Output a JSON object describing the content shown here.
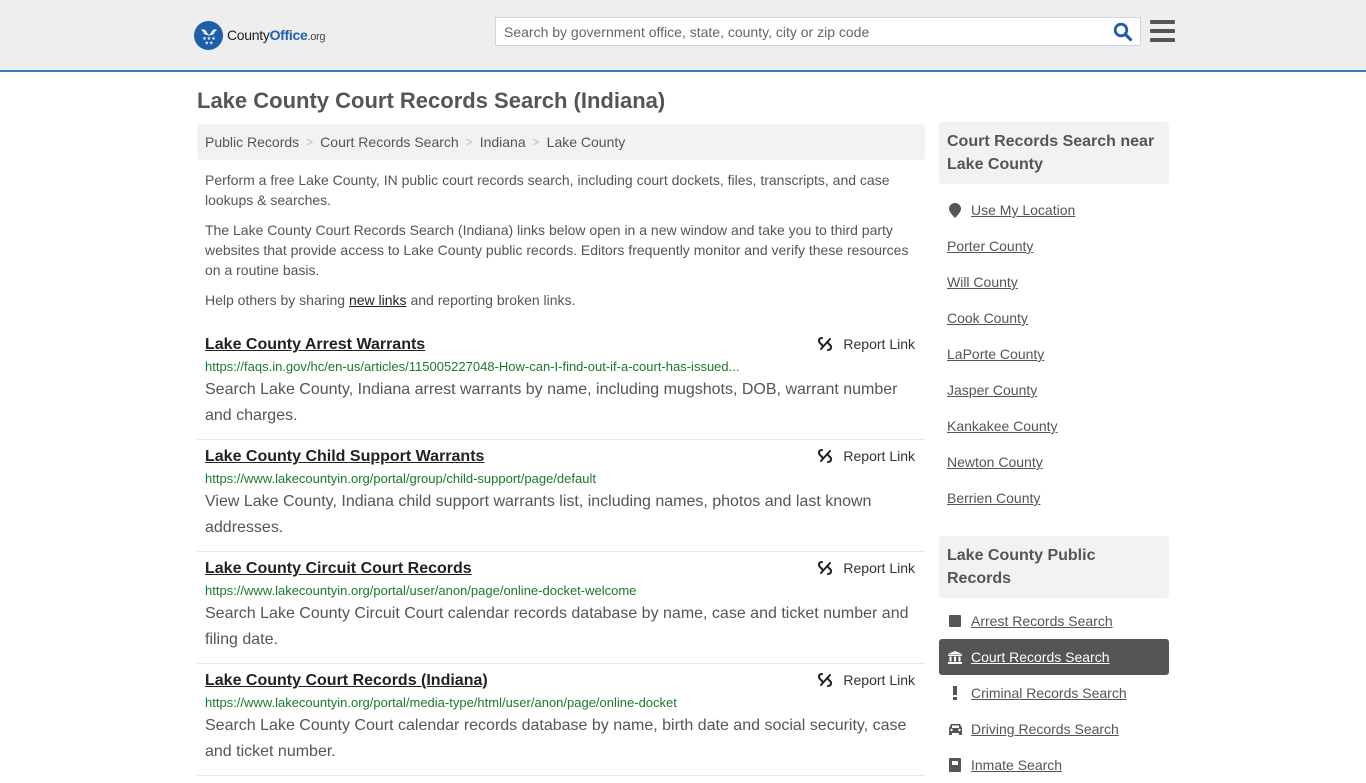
{
  "header": {
    "logo": {
      "county": "County",
      "office": "Office",
      "org": ".org"
    },
    "search": {
      "placeholder": "Search by government office, state, county, city or zip code",
      "value": ""
    },
    "colors": {
      "brand": "#1d5fa8",
      "accent_border": "#3a7ab8",
      "url_green": "#1a7a2b"
    }
  },
  "page": {
    "title": "Lake County Court Records Search (Indiana)",
    "breadcrumb": [
      "Public Records",
      "Court Records Search",
      "Indiana",
      "Lake County"
    ],
    "intro": {
      "p1": "Perform a free Lake County, IN public court records search, including court dockets, files, transcripts, and case lookups & searches.",
      "p2": "The Lake County Court Records Search (Indiana) links below open in a new window and take you to third party websites that provide access to Lake County public records. Editors frequently monitor and verify these resources on a routine basis.",
      "p3_before": "Help others by sharing ",
      "p3_link": "new links",
      "p3_after": " and reporting broken links."
    },
    "report_label": "Report Link",
    "results": [
      {
        "title": "Lake County Arrest Warrants",
        "url": "https://faqs.in.gov/hc/en-us/articles/115005227048-How-can-I-find-out-if-a-court-has-issued...",
        "desc": "Search Lake County, Indiana arrest warrants by name, including mugshots, DOB, warrant number and charges."
      },
      {
        "title": "Lake County Child Support Warrants",
        "url": "https://www.lakecountyin.org/portal/group/child-support/page/default",
        "desc": "View Lake County, Indiana child support warrants list, including names, photos and last known addresses."
      },
      {
        "title": "Lake County Circuit Court Records",
        "url": "https://www.lakecountyin.org/portal/user/anon/page/online-docket-welcome",
        "desc": "Search Lake County Circuit Court calendar records database by name, case and ticket number and filing date."
      },
      {
        "title": "Lake County Court Records (Indiana)",
        "url": "https://www.lakecountyin.org/portal/media-type/html/user/anon/page/online-docket",
        "desc": "Search Lake County Court calendar records database by name, birth date and social security, case and ticket number."
      }
    ]
  },
  "sidebar": {
    "nearby": {
      "heading": "Court Records Search near Lake County",
      "use_location": "Use My Location",
      "counties": [
        "Porter County",
        "Will County",
        "Cook County",
        "LaPorte County",
        "Jasper County",
        "Kankakee County",
        "Newton County",
        "Berrien County"
      ]
    },
    "public_records": {
      "heading": "Lake County Public Records",
      "items": [
        {
          "label": "Arrest Records Search",
          "icon": "square-icon",
          "active": false
        },
        {
          "label": "Court Records Search",
          "icon": "courthouse-icon",
          "active": true
        },
        {
          "label": "Criminal Records Search",
          "icon": "exclamation-icon",
          "active": false
        },
        {
          "label": "Driving Records Search",
          "icon": "car-icon",
          "active": false
        },
        {
          "label": "Inmate Search",
          "icon": "inmate-icon",
          "active": false
        }
      ]
    }
  }
}
